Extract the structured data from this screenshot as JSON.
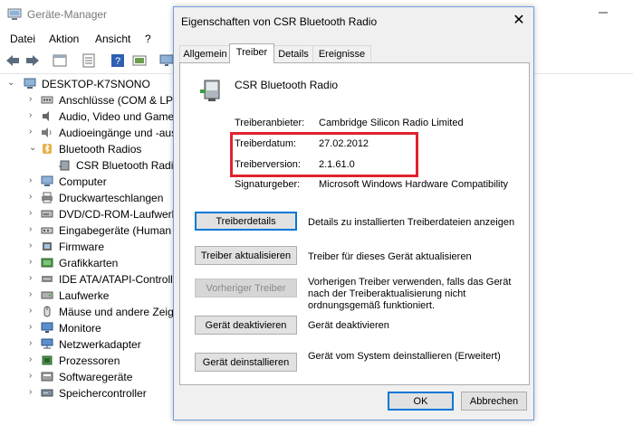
{
  "colors": {
    "accent": "#0078d7",
    "highlight": "#e0222f",
    "dialog_bg": "#f0f0f0"
  },
  "device_manager": {
    "title": "Geräte-Manager",
    "menu": [
      "Datei",
      "Aktion",
      "Ansicht",
      "?"
    ],
    "tree": [
      {
        "label": "DESKTOP-K7SNONO",
        "icon": "computer-root-icon",
        "expanded": true
      },
      {
        "label": "Anschlüsse (COM & LPT)",
        "icon": "port-icon"
      },
      {
        "label": "Audio, Video und Gamecontroller",
        "icon": "audio-icon"
      },
      {
        "label": "Audioeingänge und -ausgänge",
        "icon": "speaker-icon"
      },
      {
        "label": "Bluetooth Radios",
        "icon": "bluetooth-icon",
        "expanded": true
      },
      {
        "label": "CSR Bluetooth Radio",
        "icon": "bluetooth-device-icon",
        "child": true
      },
      {
        "label": "Computer",
        "icon": "computer-icon"
      },
      {
        "label": "Druckwarteschlangen",
        "icon": "printer-icon"
      },
      {
        "label": "DVD/CD-ROM-Laufwerke",
        "icon": "dvd-icon"
      },
      {
        "label": "Eingabegeräte (Human Interface Devices)",
        "icon": "hid-icon"
      },
      {
        "label": "Firmware",
        "icon": "firmware-icon"
      },
      {
        "label": "Grafikkarten",
        "icon": "display-adapter-icon"
      },
      {
        "label": "IDE ATA/ATAPI-Controller",
        "icon": "ide-icon"
      },
      {
        "label": "Laufwerke",
        "icon": "disk-icon"
      },
      {
        "label": "Mäuse und andere Zeigegeräte",
        "icon": "mouse-icon"
      },
      {
        "label": "Monitore",
        "icon": "monitor-icon"
      },
      {
        "label": "Netzwerkadapter",
        "icon": "network-icon"
      },
      {
        "label": "Prozessoren",
        "icon": "cpu-icon"
      },
      {
        "label": "Softwaregeräte",
        "icon": "software-device-icon"
      },
      {
        "label": "Speichercontroller",
        "icon": "storage-icon"
      }
    ]
  },
  "dialog": {
    "title": "Eigenschaften von CSR Bluetooth Radio",
    "close": "✕",
    "tabs": [
      "Allgemein",
      "Treiber",
      "Details",
      "Ereignisse"
    ],
    "active_tab": "Treiber",
    "device_name": "CSR Bluetooth Radio",
    "info": [
      {
        "label": "Treiberanbieter:",
        "value": "Cambridge Silicon Radio Limited"
      },
      {
        "label": "Treiberdatum:",
        "value": "27.02.2012"
      },
      {
        "label": "Treiberversion:",
        "value": "2.1.61.0"
      },
      {
        "label": "Signaturgeber:",
        "value": "Microsoft Windows Hardware Compatibility"
      }
    ],
    "actions": [
      {
        "label": "Treiberdetails",
        "desc": "Details zu installierten Treiberdateien anzeigen",
        "enabled": true,
        "primary": true
      },
      {
        "label": "Treiber aktualisieren",
        "desc": "Treiber für dieses Gerät aktualisieren",
        "enabled": true
      },
      {
        "label": "Vorheriger Treiber",
        "desc": "Vorherigen Treiber verwenden, falls das Gerät nach der Treiberaktualisierung nicht ordnungsgemäß funktioniert.",
        "enabled": false
      },
      {
        "label": "Gerät deaktivieren",
        "desc": "Gerät deaktivieren",
        "enabled": true
      },
      {
        "label": "Gerät deinstallieren",
        "desc": "Gerät vom System deinstallieren (Erweitert)",
        "enabled": true
      }
    ],
    "ok": "OK",
    "cancel": "Abbrechen"
  }
}
